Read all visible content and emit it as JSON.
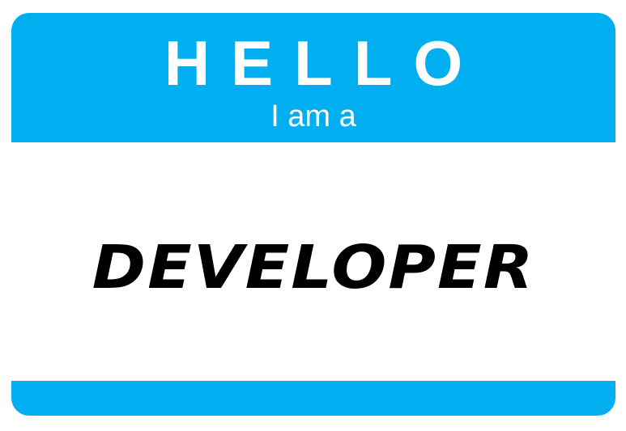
{
  "badge": {
    "greeting": "HELLO",
    "intro": "I am a",
    "name": "DEVELOPER",
    "accent_color": "#01aef0"
  }
}
